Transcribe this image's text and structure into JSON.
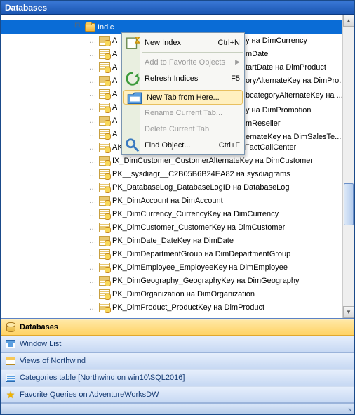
{
  "title": "Databases",
  "tree": {
    "header_label": "Indic",
    "items": [
      "A",
      "A",
      "A",
      "A",
      "A",
      "A",
      "A",
      "A",
      "AK_FactCallCenter_DateKey_Shift на FactCallCenter",
      "IX_DimCustomer_CustomerAlternateKey на DimCustomer",
      "PK__sysdiagr__C2B05B6B24EA82 на sysdiagrams",
      "PK_DatabaseLog_DatabaseLogID на DatabaseLog",
      "PK_DimAccount на DimAccount",
      "PK_DimCurrency_CurrencyKey на DimCurrency",
      "PK_DimCustomer_CustomerKey на DimCustomer",
      "PK_DimDate_DateKey на DimDate",
      "PK_DimDepartmentGroup на DimDepartmentGroup",
      "PK_DimEmployee_EmployeeKey на DimEmployee",
      "PK_DimGeography_GeographyKey на DimGeography",
      "PK_DimOrganization на DimOrganization",
      "PK_DimProduct_ProductKey на DimProduct"
    ],
    "peek_items": [
      "y на DimCurrency",
      "mDate",
      "tartDate на DimProduct",
      "oryAlternateKey на DimPro...",
      "bcategoryAlternateKey на ...",
      "y на DimPromotion",
      "mReseller",
      "ernateKey на DimSalesTe..."
    ]
  },
  "context_menu": {
    "items": [
      {
        "label": "New Index",
        "accel": "Ctrl+N",
        "icon": "new"
      },
      {
        "label": "Add to Favorite Objects",
        "submenu": true,
        "disabled": true
      },
      {
        "label": "Refresh Indices",
        "accel": "F5",
        "icon": "refresh"
      },
      {
        "label": "New Tab from Here...",
        "icon": "tab",
        "highlight": true
      },
      {
        "label": "Rename Current Tab...",
        "disabled": true
      },
      {
        "label": "Delete Current Tab",
        "disabled": true
      },
      {
        "label": "Find Object...",
        "accel": "Ctrl+F",
        "icon": "find"
      }
    ]
  },
  "panels": [
    {
      "label": "Databases",
      "icon": "db",
      "active": true
    },
    {
      "label": "Window List",
      "icon": "win"
    },
    {
      "label": "Views of Northwind",
      "icon": "view"
    },
    {
      "label": "Categories table [Northwind on win10\\SQL2016]",
      "icon": "cat"
    },
    {
      "label": "Favorite Queries on AdventureWorksDW",
      "icon": "star"
    }
  ]
}
